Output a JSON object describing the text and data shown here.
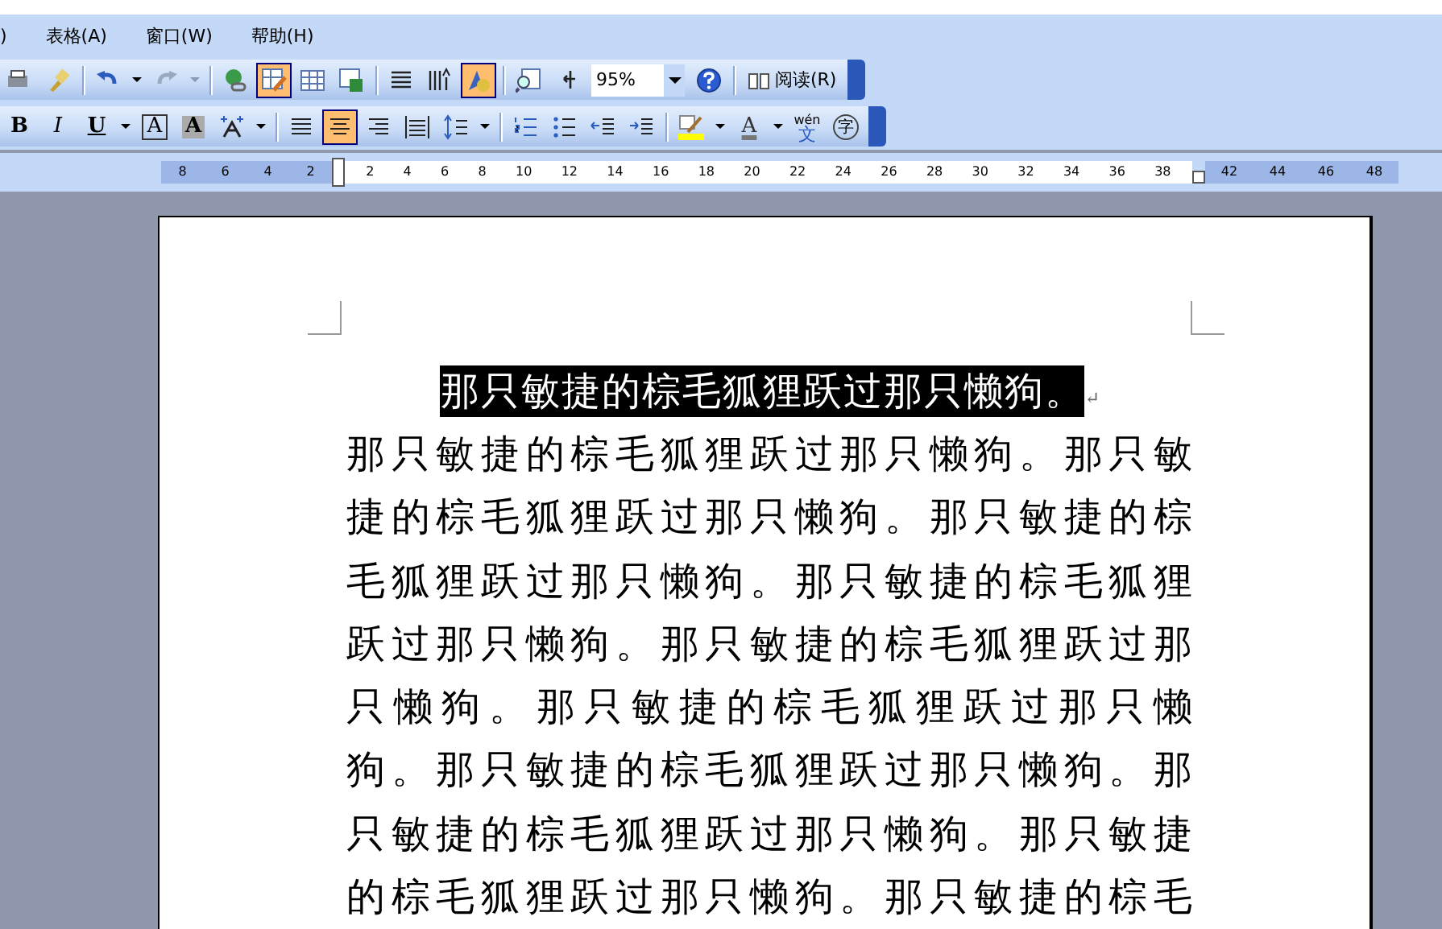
{
  "menu_bar": {
    "items": [
      ")",
      "表格(A)",
      "窗口(W)",
      "帮助(H)"
    ]
  },
  "standard_toolbar": {
    "drawing_button_pressed": true,
    "shapes_button_pressed": true,
    "zoom": "95%",
    "read_button": "阅读(R)"
  },
  "formatting_toolbar": {
    "bold": "B",
    "italic": "I",
    "underline": "U",
    "char_border": "A",
    "char_shading": "A",
    "alignment_buttons": [
      {
        "kind": "justify",
        "selected": false
      },
      {
        "kind": "center",
        "selected": true
      },
      {
        "kind": "right",
        "selected": false
      },
      {
        "kind": "distributed",
        "selected": false
      }
    ],
    "font_color": "A",
    "phonetic": "wén",
    "phonetic_char": "文",
    "enclose_char": "字"
  },
  "ruler": {
    "left_margin_labels": [
      "8",
      "6",
      "4",
      "2"
    ],
    "text_labels": [
      "2",
      "4",
      "6",
      "8",
      "10",
      "12",
      "14",
      "16",
      "18",
      "20",
      "22",
      "24",
      "26",
      "28",
      "30",
      "32",
      "34",
      "36",
      "38"
    ],
    "right_margin_labels": [
      "42",
      "44",
      "46",
      "48"
    ]
  },
  "document": {
    "heading": {
      "text": "那只敏捷的棕毛狐狸跃过那只懒狗。",
      "selected": true,
      "mark": "↵"
    },
    "body_lines": [
      "那只敏捷的棕毛狐狸跃过那只懒狗。那只敏",
      "捷的棕毛狐狸跃过那只懒狗。那只敏捷的棕",
      "毛狐狸跃过那只懒狗。那只敏捷的棕毛狐狸",
      "跃过那只懒狗。那只敏捷的棕毛狐狸跃过那",
      "只懒狗。那只敏捷的棕毛狐狸跃过那只懒",
      "狗。那只敏捷的棕毛狐狸跃过那只懒狗。那",
      "只敏捷的棕毛狐狸跃过那只懒狗。那只敏捷",
      "的棕毛狐狸跃过那只懒狗。那只敏捷的棕毛"
    ]
  }
}
